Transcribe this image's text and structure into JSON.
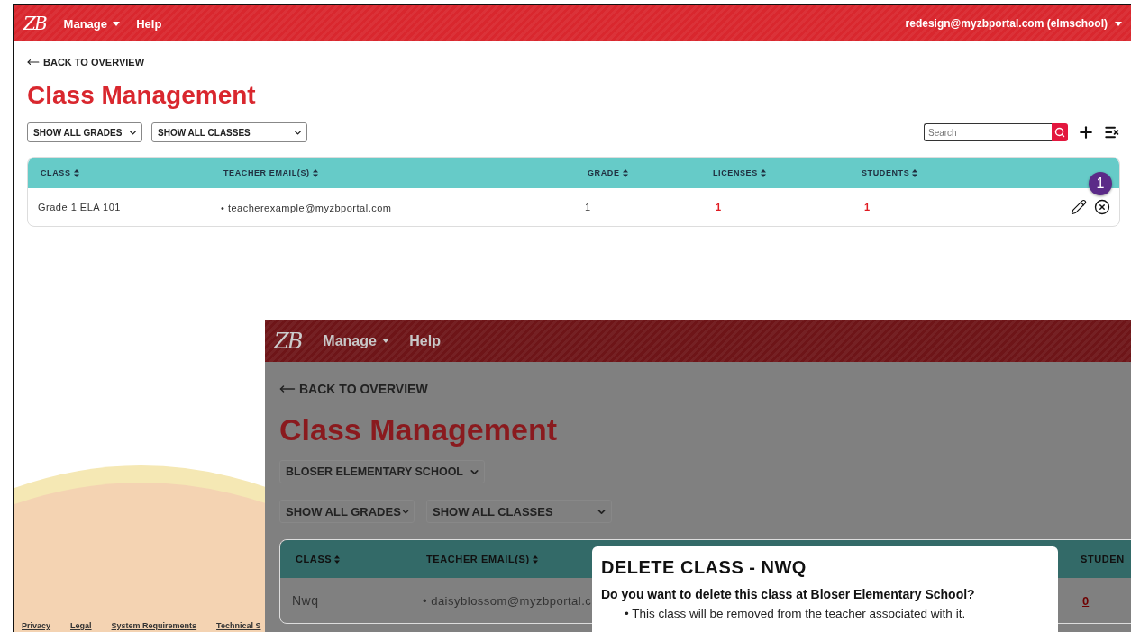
{
  "header": {
    "logo": "ZB",
    "menu": [
      {
        "label": "Manage",
        "dropdown": true
      },
      {
        "label": "Help",
        "dropdown": false
      }
    ],
    "account": "redesign@myzbportal.com (elmschool)"
  },
  "back_link": "BACK TO OVERVIEW",
  "title": "Class Management",
  "filters": [
    "SHOW ALL GRADES",
    "SHOW ALL CLASSES"
  ],
  "search": {
    "placeholder": "Search"
  },
  "table": {
    "columns": [
      "CLASS",
      "TEACHER EMAIL(S)",
      "GRADE",
      "LICENSES",
      "STUDENTS"
    ],
    "rows": [
      {
        "class": "Grade 1 ELA 101",
        "teacher_emails": [
          "• teacherexample@myzbportal.com"
        ],
        "grade": "1",
        "licenses": "1",
        "students": "1"
      }
    ]
  },
  "step_badge": "1",
  "footer_links": [
    "Privacy",
    "Legal",
    "System Requirements",
    "Technical S"
  ],
  "inset": {
    "header": {
      "logo": "ZB",
      "menu": [
        {
          "label": "Manage",
          "dropdown": true
        },
        {
          "label": "Help",
          "dropdown": false
        }
      ]
    },
    "back_link": "BACK TO OVERVIEW",
    "title": "Class Management",
    "school_select": "BLOSER ELEMENTARY SCHOOL",
    "filters": [
      "SHOW ALL GRADES",
      "SHOW ALL CLASSES"
    ],
    "table": {
      "columns": [
        "CLASS",
        "TEACHER EMAIL(S)",
        "STUDEN"
      ],
      "rows": [
        {
          "class": "Nwq",
          "teacher_emails": [
            "• daisyblossom@myzbportal.c"
          ],
          "students": "0"
        }
      ]
    },
    "dialog": {
      "title": "DELETE CLASS - NWQ",
      "question": "Do you want to delete this class at Bloser Elementary School?",
      "bullets": [
        "• This class will be removed from the teacher associated with it."
      ]
    }
  }
}
